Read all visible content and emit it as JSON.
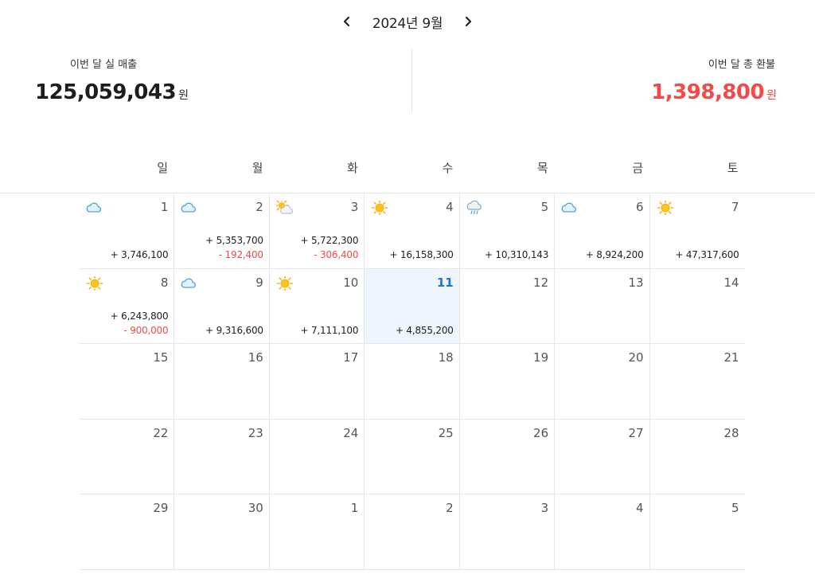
{
  "header": {
    "title": "2024년 9월",
    "prev_icon": "chevron-left-icon",
    "next_icon": "chevron-right-icon"
  },
  "summary": {
    "sales_label": "이번 달 실 매출",
    "sales_value": "125,059,043",
    "refund_label": "이번 달 총 환불",
    "refund_value": "1,398,800",
    "unit": "원"
  },
  "weekdays": [
    "일",
    "월",
    "화",
    "수",
    "목",
    "금",
    "토"
  ],
  "colors": {
    "refund": "#f04b4b",
    "today": "#1a73e8",
    "today_bg": "#eef5fe"
  },
  "weeks": [
    [
      {
        "day": "1",
        "weather": "cloud",
        "sales": "+ 3,746,100"
      },
      {
        "day": "2",
        "weather": "cloud",
        "sales": "+ 5,353,700",
        "refund": "- 192,400"
      },
      {
        "day": "3",
        "weather": "partly-sunny",
        "sales": "+ 5,722,300",
        "refund": "- 306,400"
      },
      {
        "day": "4",
        "weather": "sun",
        "sales": "+ 16,158,300"
      },
      {
        "day": "5",
        "weather": "rain",
        "sales": "+ 10,310,143"
      },
      {
        "day": "6",
        "weather": "cloud",
        "sales": "+ 8,924,200"
      },
      {
        "day": "7",
        "weather": "sun",
        "sales": "+ 47,317,600"
      }
    ],
    [
      {
        "day": "8",
        "weather": "sun",
        "sales": "+ 6,243,800",
        "refund": "- 900,000"
      },
      {
        "day": "9",
        "weather": "cloud",
        "sales": "+ 9,316,600"
      },
      {
        "day": "10",
        "weather": "sun",
        "sales": "+ 7,111,100"
      },
      {
        "day": "11",
        "today": true,
        "sales": "+ 4,855,200"
      },
      {
        "day": "12"
      },
      {
        "day": "13"
      },
      {
        "day": "14"
      }
    ],
    [
      {
        "day": "15"
      },
      {
        "day": "16"
      },
      {
        "day": "17"
      },
      {
        "day": "18"
      },
      {
        "day": "19"
      },
      {
        "day": "20"
      },
      {
        "day": "21"
      }
    ],
    [
      {
        "day": "22"
      },
      {
        "day": "23"
      },
      {
        "day": "24"
      },
      {
        "day": "25"
      },
      {
        "day": "26"
      },
      {
        "day": "27"
      },
      {
        "day": "28"
      }
    ],
    [
      {
        "day": "29"
      },
      {
        "day": "30"
      },
      {
        "day": "1",
        "other": true
      },
      {
        "day": "2",
        "other": true
      },
      {
        "day": "3",
        "other": true
      },
      {
        "day": "4",
        "other": true
      },
      {
        "day": "5",
        "other": true
      }
    ]
  ]
}
